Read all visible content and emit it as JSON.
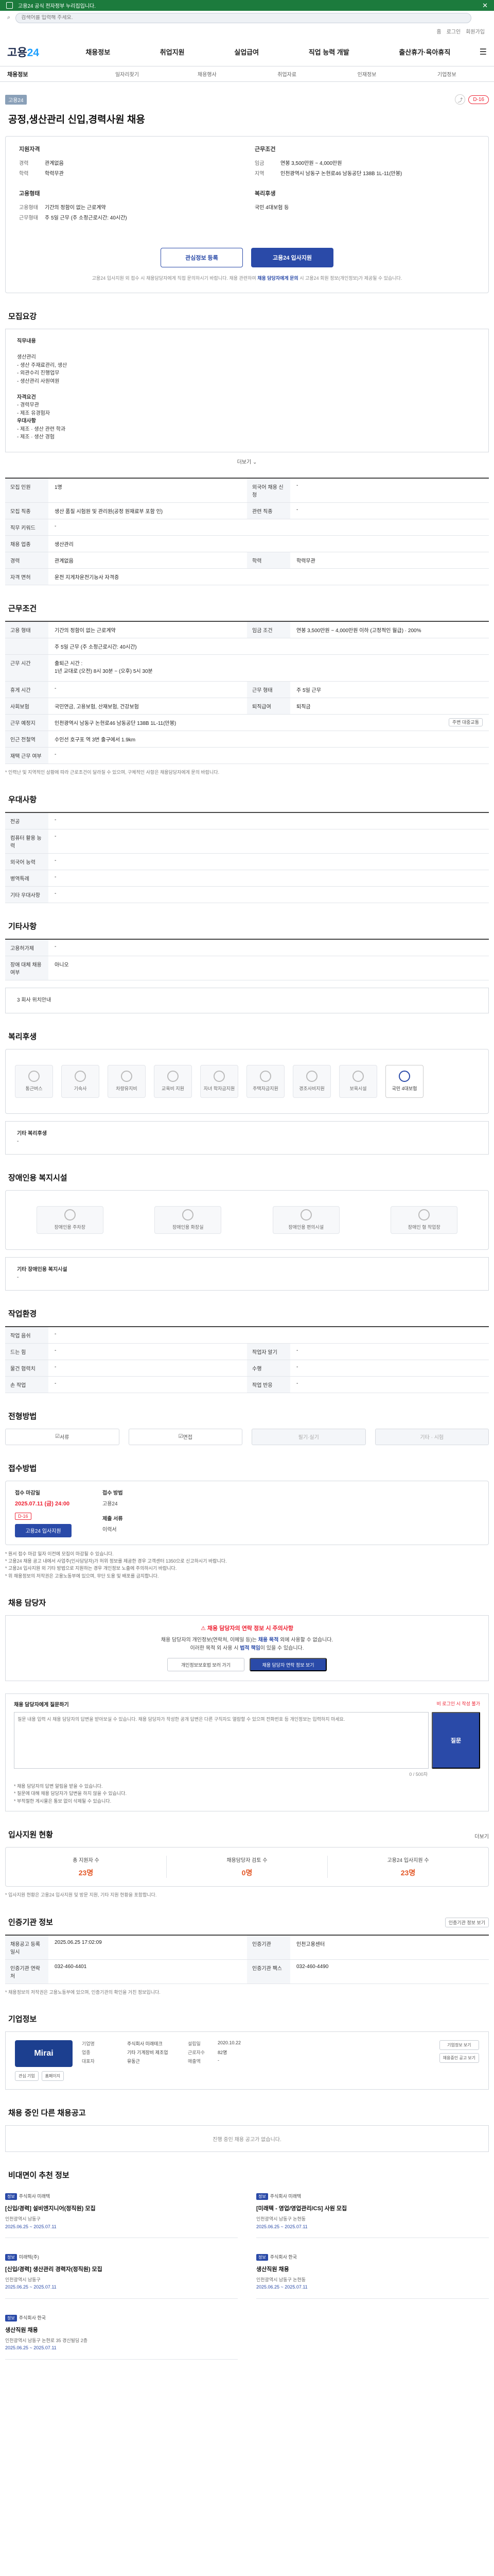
{
  "banner": {
    "text": "고용24 공식 전자정부 누리집입니다."
  },
  "search": {
    "placeholder": "검색어를 입력해 주세요."
  },
  "util": {
    "home": "홈",
    "login": "로그인",
    "join": "회원가입"
  },
  "gnb": {
    "logo_a": "고용",
    "logo_b": "24",
    "menu": [
      "채용정보",
      "취업지원",
      "실업급여",
      "직업 능력 개발",
      "출산휴가·육아휴직"
    ]
  },
  "lnb": [
    "채용정보",
    "일자리찾기",
    "채용행사",
    "취업자료",
    "인재정보",
    "기업정보"
  ],
  "job": {
    "tag": "고용24",
    "deadline": "D-16",
    "title": "공정,생산관리 신입,경력사원 채용",
    "left_title": "지원자격",
    "left": [
      {
        "k": "경력",
        "v": "관계없음"
      },
      {
        "k": "학력",
        "v": "학력무관"
      }
    ],
    "right_title": "근무조건",
    "right": [
      {
        "k": "임금",
        "v": "연봉 3,500만원 ~ 4,000만원"
      },
      {
        "k": "지역",
        "v": "인천광역시 남동구 논현로46 남동공단 138B 1L-11(만봉)"
      }
    ],
    "left2_title": "고용형태",
    "left2": [
      {
        "k": "고용형태",
        "v": "기간의 정함이 없는 근로계약"
      },
      {
        "k": "근무형태",
        "v": "주 5일 근무 (주 소정근로시간: 40시간)"
      }
    ],
    "right2_title": "복리후생",
    "right2": [
      {
        "k": "",
        "v": "국민 4대보험 등"
      }
    ],
    "btn_scrap": "관심정보 등록",
    "btn_apply": "고용24 입사지원",
    "note_a": "고용24 입사지원 외 접수 시 채용담당자에게 직접 문의하시기 바랍니다. 채용 관련하여 ",
    "note_b": "채용 담당자에게 문의",
    "note_c": " 시 고용24 회원 정보(개인정보)가 제공될 수 있습니다."
  },
  "recruit": {
    "title": "모집요강",
    "lines": [
      "직무내용",
      "",
      "생산관리",
      "- 생산 주재료관리, 생산",
      "- 외관수리 진행업무",
      "- 생산관리 사원여원",
      "",
      "자격요건",
      "- 경력무관",
      "- 제조 유경험자",
      "우대사항",
      "- 제조 · 생산 관련 학과",
      "- 제조 · 생산 경험"
    ],
    "more": "더보기",
    "rows": [
      {
        "th": "모집 인원",
        "td": "1명",
        "th2": "외국어 채용 신청",
        "td2": "-"
      },
      {
        "th": "모집 직종",
        "td": "생산 품질 시험원 및 관리원(공정 원재료부 포함 인)",
        "th2": "관련 직종",
        "td2": "-"
      },
      {
        "th": "직무 키워드",
        "td": "-",
        "th2": "",
        "td2": ""
      },
      {
        "th": "채용 업종",
        "td": "생산관리",
        "th2": "",
        "td2": ""
      },
      {
        "th": "경력",
        "td": "관계없음",
        "th2": "학력",
        "td2": "학력무관"
      },
      {
        "th": "자격 면허",
        "td": "운전 지게차운전기능사 자격증",
        "th2": "",
        "td2": ""
      }
    ]
  },
  "conditions": {
    "title": "근무조건",
    "rows": [
      {
        "th": "고용 형태",
        "td": "기간의 정함이 없는 근로계약",
        "th2": "임금 조건",
        "td2": "연봉 3,500만원 ~ 4,000만원 이하 (고정적인 월급) · 200%"
      },
      {
        "th": "",
        "td": "주 5일 근무 (주 소정근로시간: 40시간)",
        "th2": "",
        "td2": ""
      },
      {
        "th": "근무 시간",
        "td": "출퇴근 시간 :\n 1년 교대로 (오전) 8시 30분 ~ (오후) 5시 30분",
        "th2": "",
        "td2": ""
      },
      {
        "th": "휴게 시간",
        "td": "-",
        "th2": "근무 형태",
        "td2": "주 5일 근무"
      },
      {
        "th": "사회보험",
        "td": "국민연금, 고용보험, 산재보험, 건강보험",
        "th2": "퇴직급여",
        "td2": "퇴직금"
      },
      {
        "th": "근무 예정지",
        "td": "인천광역시 남동구 논현로46 남동공단 138B 1L-11(만봉)",
        "th2": "",
        "td2": "주변 대중교통"
      },
      {
        "th": "인근 전철역",
        "td": "수인선 호구포 역 3번 출구에서 1.9km",
        "th2": "",
        "td2": ""
      },
      {
        "th": "재택 근무 여부",
        "td": "-",
        "th2": "",
        "td2": ""
      }
    ],
    "note": "* 인력난 및 지역적인 상황에 따라 근로조건이 달라질 수 있으며, 구체적인 사항은 채용담당자에게 문의 바랍니다."
  },
  "preference": {
    "title": "우대사항",
    "rows": [
      {
        "th": "전공",
        "td": "-"
      },
      {
        "th": "컴퓨터 활용 능력",
        "td": "-"
      },
      {
        "th": "외국어 능력",
        "td": "-"
      },
      {
        "th": "병역특례",
        "td": "-"
      },
      {
        "th": "기타 우대사항",
        "td": "-"
      }
    ]
  },
  "etc": {
    "title": "기타사항",
    "rows": [
      {
        "th": "고용허가제",
        "td": "-"
      },
      {
        "th": "장애 대체 채용 여부",
        "td": "아니오"
      }
    ],
    "more": "3 회사 위치안내"
  },
  "welfare": {
    "title": "복리후생",
    "items": [
      "통근버스",
      "기숙사",
      "차량유지비",
      "교육비 지원",
      "자녀 학자금지원",
      "주택자금지원",
      "경조사비지원",
      "보육시설",
      "국민 4대보험"
    ],
    "etc_title": "기타 복리후생",
    "etc_value": "-"
  },
  "disability": {
    "title": "장애인용 복지시설",
    "items": [
      "장애인용 주차장",
      "장애인용 화장실",
      "장애인용 편의시설",
      "장애인 형 작업장"
    ],
    "etc_title": "기타 장애인용 복지시설",
    "etc_value": "-"
  },
  "workenv": {
    "title": "작업환경",
    "rows": [
      {
        "th": "작업 음쉬",
        "td": "-",
        "th2": "",
        "td2": ""
      },
      {
        "th": "드는 힘",
        "td": "-",
        "th2": "작업자 알기",
        "td2": "-"
      },
      {
        "th": "물건 협력치",
        "td": "-",
        "th2": "수행",
        "td2": "-"
      },
      {
        "th": "손 작업",
        "td": "-",
        "th2": "작업 반응",
        "td2": "-"
      }
    ]
  },
  "method": {
    "title": "전형방법",
    "steps": [
      "서류",
      "면접",
      "필기·실기",
      "기타 · 시험"
    ]
  },
  "apply": {
    "title": "접수방법",
    "date_lbl": "접수 마감일",
    "date": "2025.07.11 (금) 24:00",
    "dday": "D-16",
    "btn": "고용24 입사지원",
    "method_lbl": "접수 방법",
    "method": "고용24",
    "doc_lbl": "제출 서류",
    "doc": "이력서",
    "bullets": [
      "* 원서 접수 마감 일자 이전에 모집이 마감될 수 있습니다.",
      "* 고용24 채용 공고 내에서 사업주(인사담당자)가 허위 정보를 제공한 경우 고객센터 1350으로 신고하시기 바랍니다.",
      "* 고용24 입사지원 외 기타 방법으로 지원하는 경우 개인정보 노출에 주의하시기 바랍니다.",
      "* 위 채용정보의 저작권은 고용노동부에 있으며, 무단 도용 및 배포를 금지합니다."
    ]
  },
  "manager": {
    "title": "채용 담당자",
    "warn_title": "채용 담당자의 연락 정보 시 주의사항",
    "warn_a": "채용 담당자의 개인정보(연락처, 이메일 등)는 ",
    "warn_b": "채용 목적",
    "warn_c": " 외에 사용할 수 없습니다.",
    "warn_d": "이러한 목적 외 사용 시 ",
    "warn_e": "법적 책임",
    "warn_f": "이 있을 수 있습니다.",
    "btn_a": "개인정보보호법 보러 가기",
    "btn_b": "채용 담당자 연락 정보 보기"
  },
  "question": {
    "title": "채용 담당자에게 질문하기",
    "warn": "비 로그인 시 작성 불가",
    "placeholder": "질문 내용 입력 시 채용 담당자의 답변을 받아보실 수 있습니다. 채용 담당자가 작성한 공개 답변은 다른 구직자도 열람할 수 있으며 전화번호 등 개인정보는 입력하지 마세요.",
    "btn": "질문",
    "count": "0 / 500자",
    "bullets": [
      "* 채용 담당자의 답변 알림을 받을 수 있습니다.",
      "* 질문에 대해 채용 담당자가 답변을 하지 않을 수 있습니다.",
      "* 부적절한 게시물은 통보 없이 삭제될 수 있습니다."
    ]
  },
  "stats": {
    "title": "입사지원 현황",
    "link": "더보기",
    "items": [
      {
        "lbl": "총 지원자 수",
        "num": "23명"
      },
      {
        "lbl": "채용담당자 검토 수",
        "num": "0명"
      },
      {
        "lbl": "고용24 입사지원 수",
        "num": "23명"
      }
    ],
    "note": "* 입사지원 현황은 고용24 입사지원 및 방문 지원, 기타 지원 현황을 포함합니다."
  },
  "info": {
    "title": "인증기관 정보",
    "link": "인증기관 정보 보기",
    "rows": [
      {
        "th": "채용공고 등록일시",
        "td": "2025.06.25 17:02:09",
        "th2": "인증기관",
        "td2": "인천고용센터"
      },
      {
        "th": "인증기관 연락처",
        "td": "032-460-4401",
        "th2": "인증기관 팩스",
        "td2": "032-460-4490"
      }
    ],
    "note": "* 채용정보의 저작권은 고용노동부에 있으며, 인증기관의 확인을 거친 정보입니다."
  },
  "company": {
    "title": "기업정보",
    "logo": "Mirai",
    "btn_a": "관심 기업",
    "btn_b": "홈페이지",
    "grid": [
      {
        "k": "기업명",
        "v": "주식회사 미래테크"
      },
      {
        "k": "설립일",
        "v": "2020.10.22"
      },
      {
        "k": "업종",
        "v": "기타 기계장비 제조업"
      },
      {
        "k": "근로자수",
        "v": "82명"
      },
      {
        "k": "대표자",
        "v": "유동근"
      },
      {
        "k": "매출액",
        "v": "-"
      }
    ],
    "side_a": "기업정보 보기",
    "side_b": "채용중인 공고 보기"
  },
  "other": {
    "title": "채용 중인 다른 채용공고",
    "empty": "진행 중인 채용 공고가 없습니다."
  },
  "recs": {
    "title": "비대면이 추천 정보",
    "items": [
      {
        "badge": "정보",
        "co": "주식회사 미래텍",
        "title": "[신입/경력] 설비엔지니어(정직원) 모집",
        "meta": "인천광역시 남동구",
        "dates": "2025.06.25 ~ 2025.07.11"
      },
      {
        "badge": "정보",
        "co": "주식회사 미래텍",
        "title": "[미래텍 - 영업/영업관리/CS] 사원 모집",
        "meta": "인천광역시 남동구 논현동",
        "dates": "2025.06.25 ~ 2025.07.11"
      },
      {
        "badge": "정보",
        "co": "미래텍(주)",
        "title": "[신입/경력] 생산관리 경력자(정직원) 모집",
        "meta": "인천광역시 남동구",
        "dates": "2025.06.25 ~ 2025.07.11"
      },
      {
        "badge": "정보",
        "co": "주식회사 한국",
        "title": "생산직원 채용",
        "meta": "인천광역시 남동구 논현동",
        "dates": "2025.06.25 ~ 2025.07.11"
      },
      {
        "badge": "정보",
        "co": "주식회사 한국",
        "title": "생산직원 채용",
        "meta": "인천광역시 남동구 논현로 35 경신빌딩 2층",
        "dates": "2025.06.25 ~ 2025.07.11"
      }
    ]
  }
}
